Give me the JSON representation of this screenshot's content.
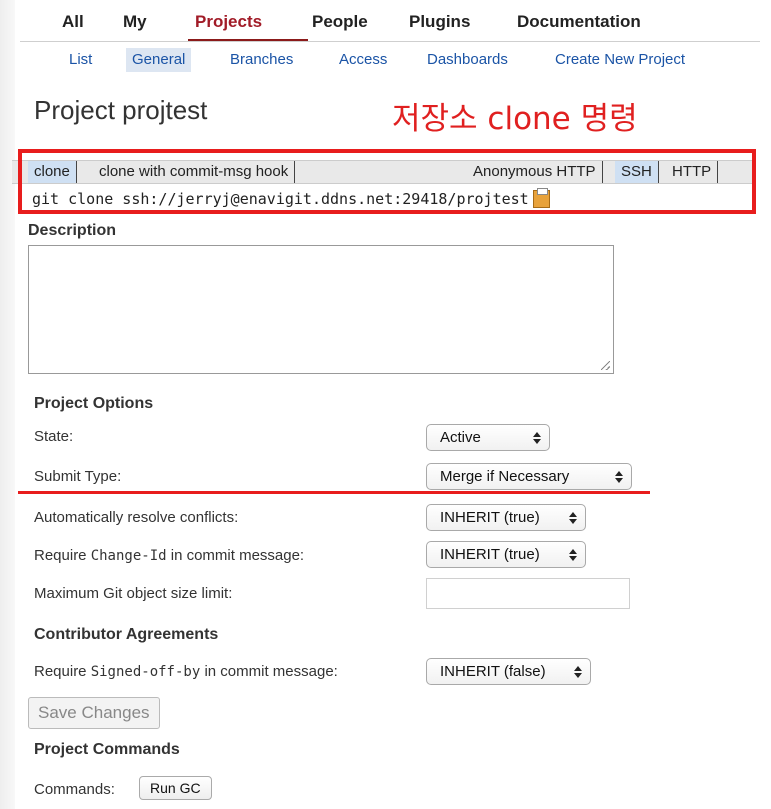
{
  "topnav": {
    "items": [
      {
        "label": "All"
      },
      {
        "label": "My"
      },
      {
        "label": "Projects",
        "active": true
      },
      {
        "label": "People"
      },
      {
        "label": "Plugins"
      },
      {
        "label": "Documentation"
      }
    ],
    "active_color": "#a11b27"
  },
  "subnav": {
    "items": [
      {
        "label": "List"
      },
      {
        "label": "General",
        "active": true
      },
      {
        "label": "Branches"
      },
      {
        "label": "Access"
      },
      {
        "label": "Dashboards"
      },
      {
        "label": "Create New Project"
      }
    ],
    "link_color": "#1b54a6"
  },
  "page_title": "Project projtest",
  "annotation": {
    "text": "저장소 clone 명령",
    "color": "#e02020"
  },
  "clone": {
    "tabs": [
      {
        "label": "clone",
        "selected": true
      },
      {
        "label": "clone with commit-msg hook",
        "selected": false
      }
    ],
    "protocols": [
      {
        "label": "Anonymous HTTP",
        "selected": false
      },
      {
        "label": "SSH",
        "selected": true
      },
      {
        "label": "HTTP",
        "selected": false
      }
    ],
    "command": "git clone ssh://jerryj@enavigit.ddns.net:29418/projtest",
    "copy_icon": "clipboard-icon"
  },
  "description": {
    "label": "Description",
    "value": ""
  },
  "project_options": {
    "heading": "Project Options",
    "state": {
      "label": "State:",
      "value": "Active"
    },
    "submit_type": {
      "label": "Submit Type:",
      "value": "Merge if Necessary"
    },
    "auto_resolve": {
      "label": "Automatically resolve conflicts:",
      "value": "INHERIT (true)"
    },
    "require_change_id": {
      "label_pre": "Require ",
      "label_code": "Change-Id",
      "label_post": " in commit message:",
      "value": "INHERIT (true)"
    },
    "max_object_size": {
      "label": "Maximum Git object size limit:",
      "value": ""
    }
  },
  "contributor_agreements": {
    "heading": "Contributor Agreements",
    "signed_off_by": {
      "label_pre": "Require ",
      "label_code": "Signed-off-by",
      "label_post": " in commit message:",
      "value": "INHERIT (false)"
    }
  },
  "save_button": "Save Changes",
  "project_commands": {
    "heading": "Project Commands",
    "label": "Commands:",
    "run_gc": "Run GC"
  },
  "highlight_color": "#e81d1d"
}
